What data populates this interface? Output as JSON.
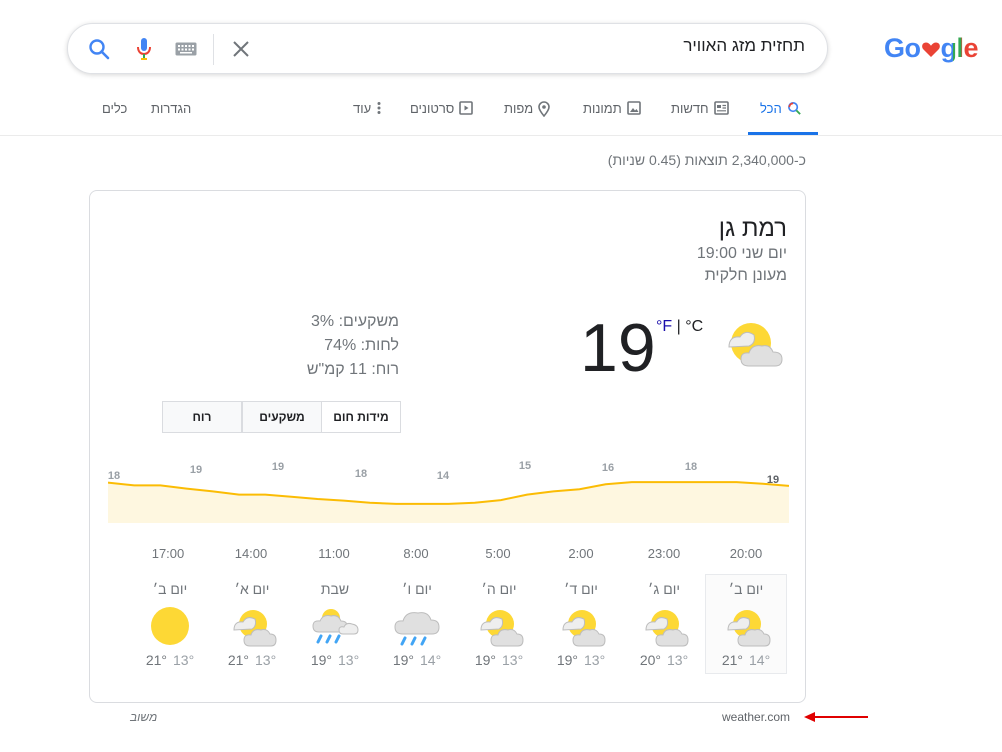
{
  "logo": {
    "prefix": "Go",
    "suffix": "gle"
  },
  "search": {
    "query": "תחזית מזג האוויר"
  },
  "tabs": [
    {
      "label": "הכל",
      "icon": "search-icon",
      "active": true
    },
    {
      "label": "חדשות",
      "icon": "news-icon"
    },
    {
      "label": "תמונות",
      "icon": "image-icon"
    },
    {
      "label": "מפות",
      "icon": "map-pin-icon"
    },
    {
      "label": "סרטונים",
      "icon": "video-icon"
    },
    {
      "label": "עוד",
      "icon": "more-vert-icon"
    }
  ],
  "tools": {
    "settings": "הגדרות",
    "tools": "כלים"
  },
  "result_stats": "כ-2,340,000 תוצאות (0.45 שניות)",
  "weather": {
    "location": "רמת גן",
    "datetime": "יום שני 19:00",
    "condition": "מעונן חלקית",
    "temperature": "19",
    "unit_c": "°C",
    "unit_sep": " | ",
    "unit_f": "°F",
    "precipitation": "משקעים: 3%",
    "humidity": "לחות: 74%",
    "wind": "רוח: 11 קמ\"ש",
    "tabs": {
      "temperature": "מידות חום",
      "precipitation": "משקעים",
      "wind": "רוח"
    },
    "hours": [
      "20:00",
      "23:00",
      "2:00",
      "5:00",
      "8:00",
      "11:00",
      "14:00",
      "17:00"
    ],
    "days": [
      {
        "name": "יום ב׳",
        "icon": "partly-cloudy-icon",
        "hi": "21°",
        "lo": "14°",
        "selected": true
      },
      {
        "name": "יום ג׳",
        "icon": "partly-cloudy-icon",
        "hi": "20°",
        "lo": "13°"
      },
      {
        "name": "יום ד׳",
        "icon": "partly-cloudy-icon",
        "hi": "19°",
        "lo": "13°"
      },
      {
        "name": "יום ה׳",
        "icon": "partly-cloudy-icon",
        "hi": "19°",
        "lo": "13°"
      },
      {
        "name": "יום ו׳",
        "icon": "rain-icon",
        "hi": "19°",
        "lo": "14°"
      },
      {
        "name": "שבת",
        "icon": "rain-sun-icon",
        "hi": "19°",
        "lo": "13°"
      },
      {
        "name": "יום א׳",
        "icon": "partly-cloudy-icon",
        "hi": "21°",
        "lo": "13°"
      },
      {
        "name": "יום ב׳",
        "icon": "sunny-icon",
        "hi": "21°",
        "lo": "13°"
      }
    ],
    "source": "weather.com",
    "feedback": "משוב"
  },
  "chart_data": {
    "type": "area",
    "x": [
      "20:00",
      "23:00",
      "2:00",
      "5:00",
      "8:00",
      "11:00",
      "14:00",
      "17:00"
    ],
    "labels": [
      19,
      18,
      16,
      15,
      14,
      18,
      19,
      19,
      18
    ],
    "series": [
      {
        "values": [
          19.2,
          18.7,
          18.7,
          18.1,
          17.6,
          17.0,
          17.0,
          16.6,
          16.2,
          15.9,
          15.5,
          15.3,
          15.3,
          15.3,
          15.5,
          16.0,
          17.0,
          17.6,
          18.0,
          18.9,
          19.3,
          19.3,
          19.3,
          19.3,
          19.3,
          19.0,
          18.6
        ]
      }
    ],
    "colors": {
      "line": "#fbbc04",
      "fill": "#fef7e0"
    }
  }
}
